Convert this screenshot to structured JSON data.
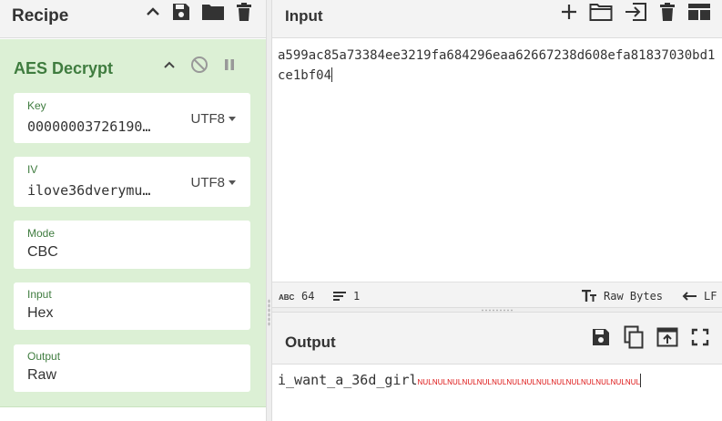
{
  "recipe": {
    "title": "Recipe",
    "icons": [
      "chevron-up-icon",
      "save-icon",
      "folder-icon",
      "trash-icon"
    ]
  },
  "operation": {
    "title": "AES Decrypt",
    "fields": {
      "key": {
        "label": "Key",
        "value": "00000003726190…",
        "encoding": "UTF8"
      },
      "iv": {
        "label": "IV",
        "value": "ilove36dverymu…",
        "encoding": "UTF8"
      },
      "mode": {
        "label": "Mode",
        "value": "CBC"
      },
      "input": {
        "label": "Input",
        "value": "Hex"
      },
      "output": {
        "label": "Output",
        "value": "Raw"
      }
    }
  },
  "input": {
    "title": "Input",
    "text": "a599ac85a73384ee3219fa684296eaa62667238d608efa81837030bd1ce1bf04",
    "status": {
      "length": "64",
      "lines": "1",
      "format": "Raw Bytes",
      "eol": "LF"
    }
  },
  "output": {
    "title": "Output",
    "text": "i_want_a_36d_girl",
    "nul_glyph": "NUL",
    "nul_count": 15
  },
  "colors": {
    "op_bg": "#dcf0d5",
    "op_title": "#3f7c3f",
    "nul": "#dd1111"
  }
}
